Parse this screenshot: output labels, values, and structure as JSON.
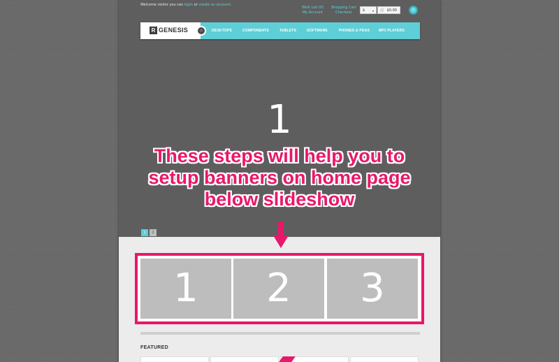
{
  "topbar": {
    "welcome_prefix": "Welcome visitor you can ",
    "login_link": "login",
    "welcome_mid": " or ",
    "create_account_link": "create an account",
    "welcome_suffix": ".",
    "wish_list": "Wish List (0)",
    "my_account": "My Account",
    "shopping_cart": "Shopping Cart",
    "checkout": "Checkout",
    "currency_value": "$",
    "currency_caret": "▾",
    "cart_icon": "🛒",
    "cart_total": "$0.00",
    "search_icon": "⌕"
  },
  "navbar": {
    "logo_mark": "R",
    "logo_text": "GENESIS",
    "home_icon": "⌂",
    "items": [
      {
        "label": "DESKTOPS"
      },
      {
        "label": "COMPONENTS"
      },
      {
        "label": "TABLETS"
      },
      {
        "label": "SOFTWARE"
      },
      {
        "label": "PHONES & PDAS"
      },
      {
        "label": "MP3 PLAYERS"
      }
    ]
  },
  "slideshow": {
    "slide_label": "1",
    "pager": [
      "1",
      "2"
    ]
  },
  "instructions": {
    "line1": "These steps will help you to",
    "line2": "setup banners on home page",
    "line3": "below slideshow"
  },
  "banners": [
    {
      "label": "1"
    },
    {
      "label": "2"
    },
    {
      "label": "3"
    }
  ],
  "featured": {
    "heading": "FEATURED"
  },
  "colors": {
    "accent": "#5ecfd6",
    "highlight": "#e8186a",
    "banner_fill": "#bdbdbd"
  }
}
